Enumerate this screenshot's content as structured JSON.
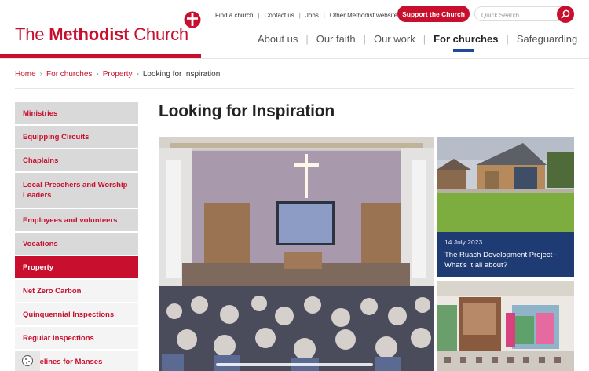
{
  "brand": {
    "name_prefix": "The ",
    "name_bold": "Methodist",
    "name_suffix": " Church",
    "accent_color": "#c8102e",
    "navy_color": "#1f3b73",
    "logo_icon": "cross-and-flame-icon"
  },
  "utility_nav": {
    "links": [
      "Find a church",
      "Contact us",
      "Jobs",
      "Other Methodist websites"
    ],
    "support_label": "Support the Church",
    "search_placeholder": "Quick Search",
    "search_icon": "search-icon"
  },
  "main_nav": {
    "items": [
      "About us",
      "Our faith",
      "Our work",
      "For churches",
      "Safeguarding"
    ],
    "active": "For churches"
  },
  "breadcrumb": {
    "items": [
      "Home",
      "For churches",
      "Property"
    ],
    "current": "Looking for Inspiration"
  },
  "sidebar": {
    "items": [
      "Ministries",
      "Equipping Circuits",
      "Chaplains",
      "Local Preachers and Worship Leaders",
      "Employees and volunteers",
      "Vocations",
      "Property",
      "Net Zero Carbon",
      "Quinquennial Inspections",
      "Regular Inspections",
      "Guidelines for Manses"
    ],
    "active": "Property"
  },
  "page": {
    "title": "Looking for Inspiration"
  },
  "cards": [
    {
      "date": "14 July 2023",
      "title": "The Ruach Development Project - What's it all about?"
    }
  ],
  "cookie_icon": "cookie-icon"
}
